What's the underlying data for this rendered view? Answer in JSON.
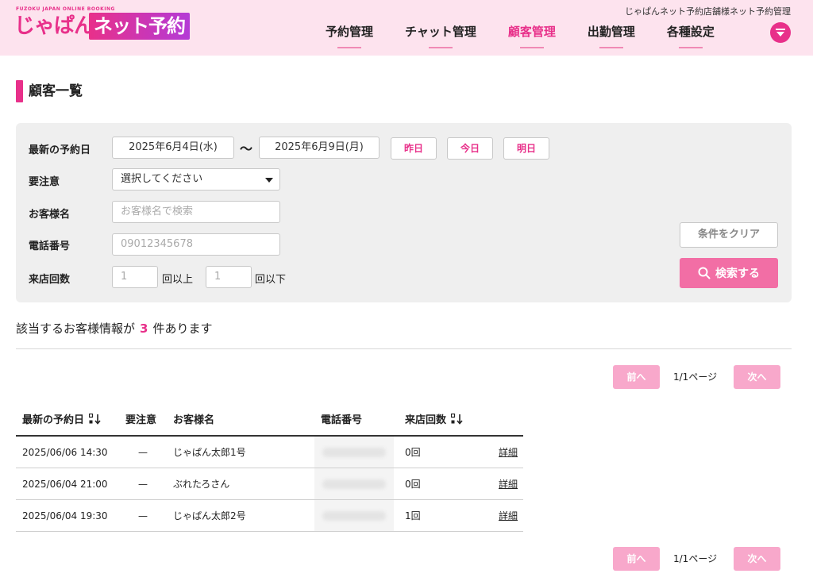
{
  "header": {
    "logo_tagline": "FUZOKU JAPAN ONLINE BOOKING",
    "logo_main": "じゃぱん!",
    "logo_badge": "ネット予約",
    "store_name": "じゃぱんネット予約店舗様ネット予約管理",
    "nav": [
      {
        "label": "予約管理",
        "active": false
      },
      {
        "label": "チャット管理",
        "active": false
      },
      {
        "label": "顧客管理",
        "active": true
      },
      {
        "label": "出勤管理",
        "active": false
      },
      {
        "label": "各種設定",
        "active": false
      }
    ],
    "menu_icon": "chevron-down-circle-icon"
  },
  "page": {
    "title": "顧客一覧"
  },
  "search": {
    "latest_reservation_label": "最新の予約日",
    "date_from": "2025年6月4日(水)",
    "date_sep": "〜",
    "date_to": "2025年6月9日(月)",
    "quick_yesterday": "昨日",
    "quick_today": "今日",
    "quick_tomorrow": "明日",
    "caution_label": "要注意",
    "caution_selected": "選択してください",
    "customer_name_label": "お客様名",
    "customer_name_placeholder": "お客様名で検索",
    "phone_label": "電話番号",
    "phone_placeholder": "09012345678",
    "visits_label": "来店回数",
    "visits_min_placeholder": "1",
    "visits_min_unit": "回以上",
    "visits_max_placeholder": "1",
    "visits_max_unit": "回以下",
    "clear_label": "条件をクリア",
    "search_label": "検索する"
  },
  "results": {
    "prefix": "該当するお客様情報が",
    "count": "3",
    "suffix": "件あります"
  },
  "pager": {
    "prev": "前へ",
    "info": "1/1ページ",
    "next": "次へ"
  },
  "table": {
    "headers": {
      "date": "最新の予約日",
      "caution": "要注意",
      "name": "お客様名",
      "phone": "電話番号",
      "visits": "来店回数"
    },
    "rows": [
      {
        "date": "2025/06/06 14:30",
        "caution": "—",
        "name": "じゃぱん太郎1号",
        "visits": "0回",
        "detail": "詳細"
      },
      {
        "date": "2025/06/04 21:00",
        "caution": "—",
        "name": "ぶれたろさん",
        "visits": "0回",
        "detail": "詳細"
      },
      {
        "date": "2025/06/04 19:30",
        "caution": "—",
        "name": "じゃぱん太郎2号",
        "visits": "1回",
        "detail": "詳細"
      }
    ]
  },
  "colors": {
    "accent": "#e8308a",
    "button_pink": "#f26ea5",
    "pager_pink": "#f8a8cb",
    "header_bg": "#fde3ee"
  }
}
